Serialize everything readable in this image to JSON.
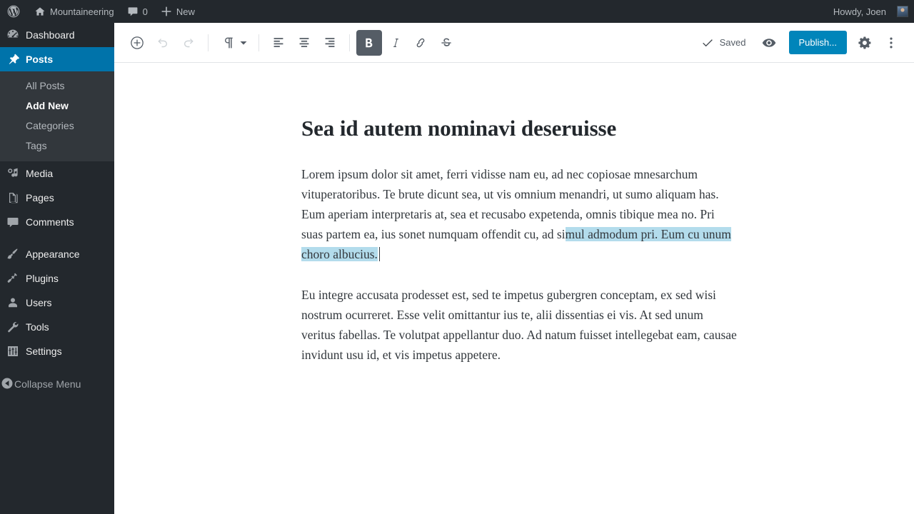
{
  "adminbar": {
    "logo_icon": "wordpress-logo-icon",
    "site": {
      "icon": "home-icon",
      "label": "Mountaineering"
    },
    "comments": {
      "icon": "comment-bubble-icon",
      "count": "0"
    },
    "new": {
      "icon": "plus-icon",
      "label": "New"
    },
    "account": {
      "greeting": "Howdy, Joen",
      "avatar": "user-avatar"
    }
  },
  "sidebar": {
    "items": [
      {
        "label": "Dashboard",
        "icon": "dashboard-icon",
        "current": false
      },
      {
        "label": "Posts",
        "icon": "pin-icon",
        "current": true
      },
      {
        "label": "Media",
        "icon": "media-icon",
        "current": false
      },
      {
        "label": "Pages",
        "icon": "pages-icon",
        "current": false
      },
      {
        "label": "Comments",
        "icon": "comment-bubble-icon",
        "current": false
      },
      {
        "label": "Appearance",
        "icon": "paintbrush-icon",
        "current": false
      },
      {
        "label": "Plugins",
        "icon": "plug-icon",
        "current": false
      },
      {
        "label": "Users",
        "icon": "user-icon",
        "current": false
      },
      {
        "label": "Tools",
        "icon": "wrench-icon",
        "current": false
      },
      {
        "label": "Settings",
        "icon": "sliders-icon",
        "current": false
      }
    ],
    "posts_submenu": [
      {
        "label": "All Posts",
        "current": false
      },
      {
        "label": "Add New",
        "current": true
      },
      {
        "label": "Categories",
        "current": false
      },
      {
        "label": "Tags",
        "current": false
      }
    ],
    "collapse": {
      "label": "Collapse Menu",
      "icon": "collapse-arrow-icon"
    },
    "current_color": "#0073aa",
    "background_color": "#23282d",
    "submenu_background": "#32373c"
  },
  "toolbar": {
    "add_block": {
      "label": "Add block",
      "icon": "plus-circle-icon"
    },
    "undo": {
      "label": "Undo",
      "icon": "undo-arrow-icon",
      "disabled": true
    },
    "redo": {
      "label": "Redo",
      "icon": "redo-arrow-icon",
      "disabled": true
    },
    "block_type": {
      "label": "Change block type",
      "icon": "paragraph-pilcrow-icon",
      "caret": "chevron-down-icon"
    },
    "align_left": {
      "label": "Align text left",
      "icon": "align-left-icon"
    },
    "align_center": {
      "label": "Align text center",
      "icon": "align-center-icon"
    },
    "align_right": {
      "label": "Align text right",
      "icon": "align-right-icon"
    },
    "bold": {
      "label": "Bold",
      "icon": "bold-icon",
      "active": true
    },
    "italic": {
      "label": "Italic",
      "icon": "italic-icon",
      "active": false
    },
    "link": {
      "label": "Link",
      "icon": "link-icon",
      "active": false
    },
    "strikethrough": {
      "label": "Strikethrough",
      "icon": "strikethrough-icon",
      "active": false
    },
    "saved_status": {
      "label": "Saved",
      "icon": "checkmark-icon"
    },
    "preview": {
      "label": "Preview",
      "icon": "eye-icon"
    },
    "publish": {
      "label": "Publish...",
      "color": "#0085ba"
    },
    "settings": {
      "label": "Settings",
      "icon": "gear-icon"
    },
    "more": {
      "label": "More options",
      "icon": "vertical-ellipsis-icon"
    }
  },
  "post": {
    "title": "Sea id autem nominavi deseruisse",
    "paragraph_1": {
      "before_selection": "Lorem ipsum dolor sit amet, ferri vidisse nam eu, ad nec copiosae mnesarchum vituperatoribus. Te brute dicunt sea, ut vis omnium menandri, ut sumo aliquam has. Eum aperiam interpretaris at, sea et recusabo expetenda, omnis tibique mea no. Pri suas partem ea, ius sonet numquam offendit cu, ad si",
      "selection": "mul admodum pri. Eum cu unum choro albucius.",
      "selection_color": "#b3dcec"
    },
    "paragraph_2": "Eu integre accusata prodesset est, sed te impetus gubergren conceptam, ex sed wisi nostrum ocurreret. Esse velit omittantur ius te, alii dissentias ei vis. At sed unum veritus fabellas. Te volutpat appellantur duo. Ad natum fuisset intellegebat eam, causae invidunt usu id, et vis impetus appetere."
  }
}
